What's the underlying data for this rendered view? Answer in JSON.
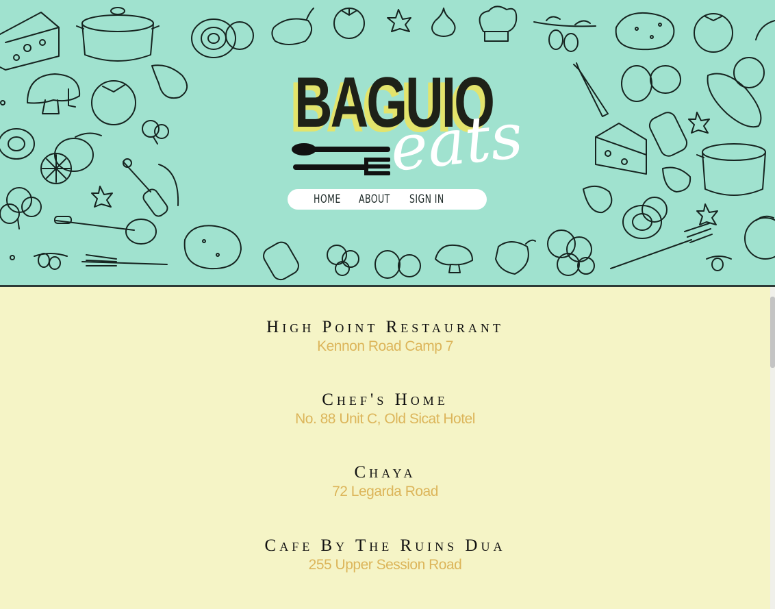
{
  "brand": {
    "word": "BAGUIO",
    "script": "eats",
    "colors": {
      "header_bg": "#a0e2cf",
      "highlight": "#e3e46c",
      "body_bg": "#f5f4c6",
      "address": "#dcb55a"
    }
  },
  "nav": {
    "home": "HOME",
    "about": "ABOUT",
    "sign_in": "SIGN IN"
  },
  "restaurants": [
    {
      "name": "High Point Restaurant",
      "address": "Kennon Road Camp 7"
    },
    {
      "name": "Chef's Home",
      "address": "No. 88 Unit C, Old Sicat Hotel"
    },
    {
      "name": "Chaya",
      "address": "72 Legarda Road"
    },
    {
      "name": "Cafe By The Ruins Dua",
      "address": "255 Upper Session Road"
    }
  ],
  "decor": {
    "icons": [
      "cheese-icon",
      "pot-icon",
      "onion-icon",
      "pepper-icon",
      "tomato-icon",
      "garlic-icon",
      "chef-hat-icon",
      "olive-branch-icon",
      "potato-icon",
      "mushroom-icon",
      "lemon-icon",
      "broccoli-icon",
      "mixer-icon",
      "ladle-icon",
      "fork-icon",
      "salt-shaker-icon",
      "egg-icon",
      "carrot-icon",
      "eggplant-icon",
      "spoon-fork-icon"
    ]
  }
}
